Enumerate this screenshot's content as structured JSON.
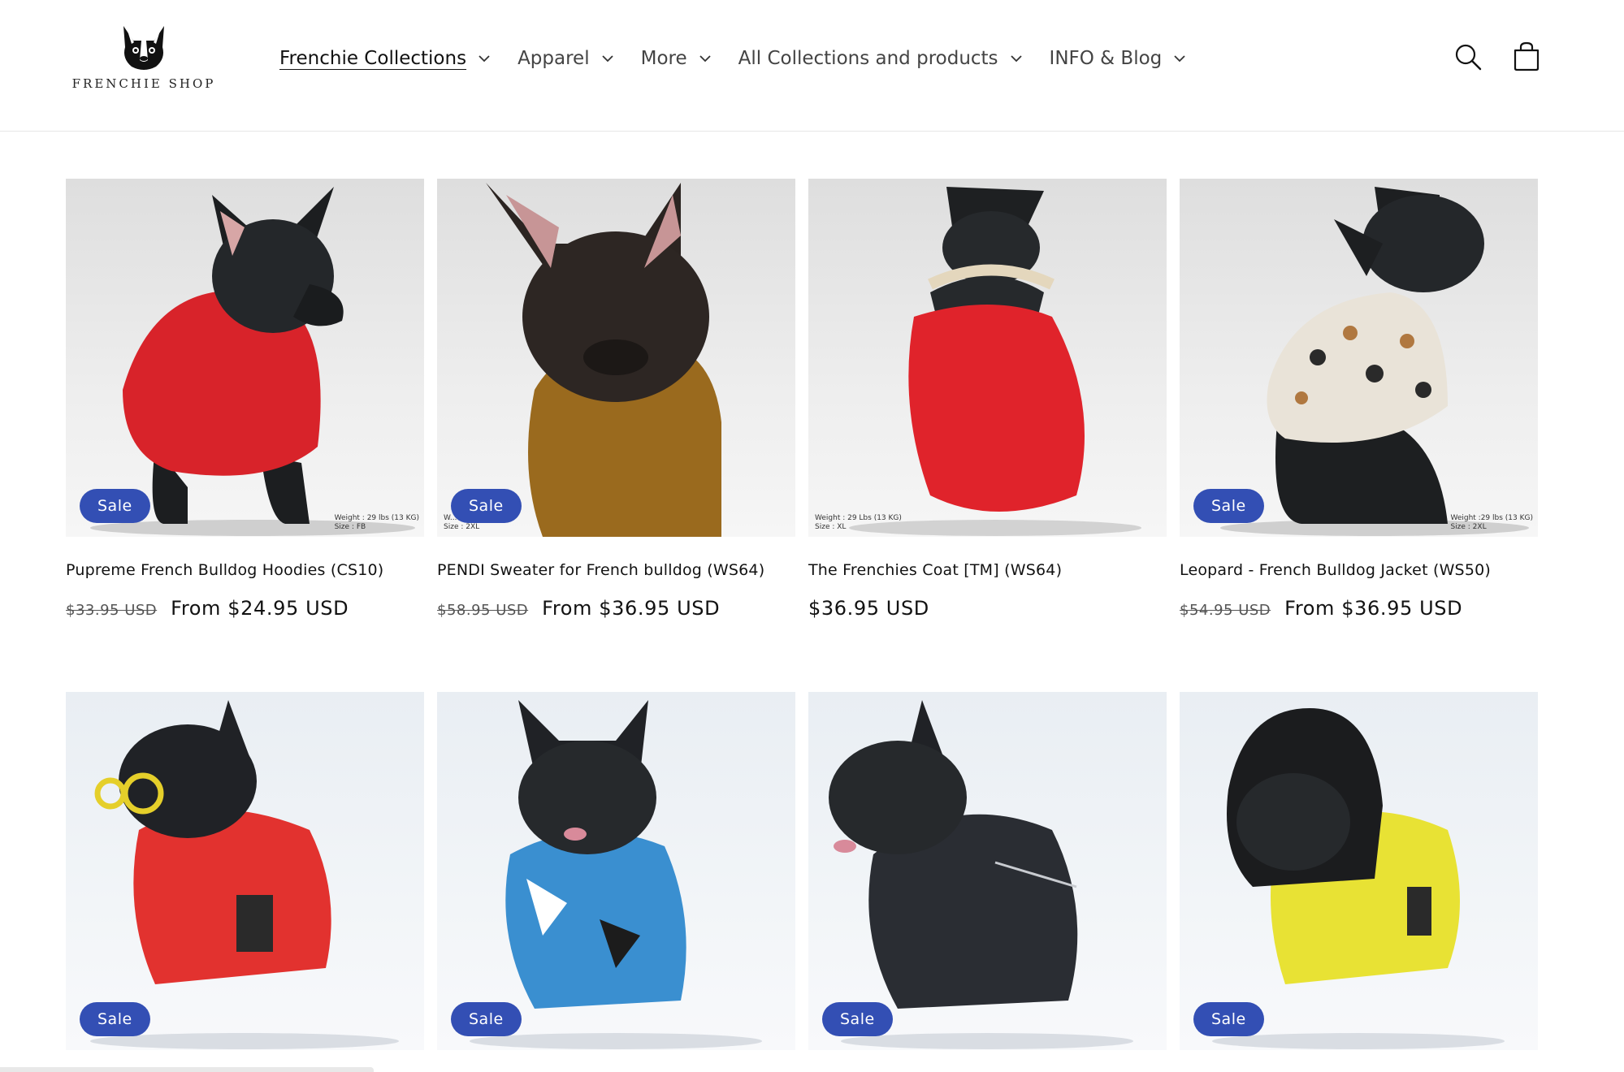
{
  "header": {
    "logo_text": "FRENCHIE SHOP",
    "nav": [
      {
        "label": "Frenchie Collections",
        "active": true
      },
      {
        "label": "Apparel",
        "active": false
      },
      {
        "label": "More",
        "active": false
      },
      {
        "label": "All Collections and products",
        "active": false
      },
      {
        "label": "INFO & Blog",
        "active": false
      }
    ],
    "icons": [
      "search-icon",
      "cart-icon"
    ]
  },
  "colors": {
    "badge": "#334fb4",
    "text": "#121212"
  },
  "products": [
    {
      "title": "Pupreme French Bulldog Hoodies (CS10)",
      "badge": "Sale",
      "price_old": "$33.95 USD",
      "price_new": "From $24.95 USD",
      "garment_color": "#d8232a",
      "image_text": "Weight : 29 lbs (13 KG)\nSize : FB"
    },
    {
      "title": "PENDI Sweater for French bulldog (WS64)",
      "badge": "Sale",
      "price_old": "$58.95 USD",
      "price_new": "From $36.95 USD",
      "garment_color": "#9a6a1e",
      "image_text": "W... 3KG)\nSize : 2XL"
    },
    {
      "title": "The Frenchies Coat [TM] (WS64)",
      "badge": "",
      "price_old": "",
      "price_new": "$36.95 USD",
      "garment_color": "#e0232b",
      "image_text": "Weight : 29 Lbs (13 KG)\nSize : XL"
    },
    {
      "title": "Leopard - French Bulldog Jacket (WS50)",
      "badge": "Sale",
      "price_old": "$54.95 USD",
      "price_new": "From $36.95 USD",
      "garment_color": "#e9e3d8",
      "image_text": "Weight :29 lbs (13 KG)\nSize : 2XL"
    },
    {
      "title": "",
      "badge": "Sale",
      "price_old": "",
      "price_new": "",
      "garment_color": "#e2322f",
      "image_text": ""
    },
    {
      "title": "",
      "badge": "Sale",
      "price_old": "",
      "price_new": "",
      "garment_color": "#3a8fd0",
      "image_text": ""
    },
    {
      "title": "",
      "badge": "Sale",
      "price_old": "",
      "price_new": "",
      "garment_color": "#2a2d33",
      "image_text": ""
    },
    {
      "title": "",
      "badge": "Sale",
      "price_old": "",
      "price_new": "",
      "garment_color": "#e8e234",
      "image_text": ""
    }
  ]
}
